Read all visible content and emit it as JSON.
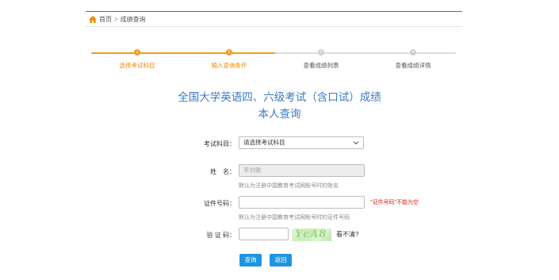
{
  "breadcrumb": {
    "home": "首页",
    "separator": ">",
    "current": "成绩查询"
  },
  "steps": [
    {
      "number": "1",
      "label": "选择考试科目",
      "state": "active"
    },
    {
      "number": "2",
      "label": "输入查询条件",
      "state": "active"
    },
    {
      "number": "3",
      "label": "查看成绩列表",
      "state": "inactive"
    },
    {
      "number": "4",
      "label": "查看成绩详情",
      "state": "inactive"
    }
  ],
  "colors": {
    "accent": "#f39a1e",
    "title": "#3c78c6",
    "button": "#1f95e0",
    "error": "#e02020"
  },
  "title": {
    "line1": "全国大学英语四、六级考试（含口试）成绩",
    "line2": "本人查询"
  },
  "form": {
    "subject": {
      "label": "考试科目：",
      "value": "请选择考试科目"
    },
    "name": {
      "label": "姓　名：",
      "value": "李刘敏",
      "hint": "默认为注册中国教育考试网账号时的姓名"
    },
    "id": {
      "label": "证件号码：",
      "value": "",
      "hint": "默认为注册中国教育考试网账号时的证件号码",
      "error": "\"证件号码\"不能为空"
    },
    "captcha": {
      "label": "验 证 码：",
      "value": "",
      "image_text": "YcA8",
      "refresh_text": "看不清?"
    }
  },
  "buttons": {
    "query": "查询",
    "back": "返回"
  }
}
